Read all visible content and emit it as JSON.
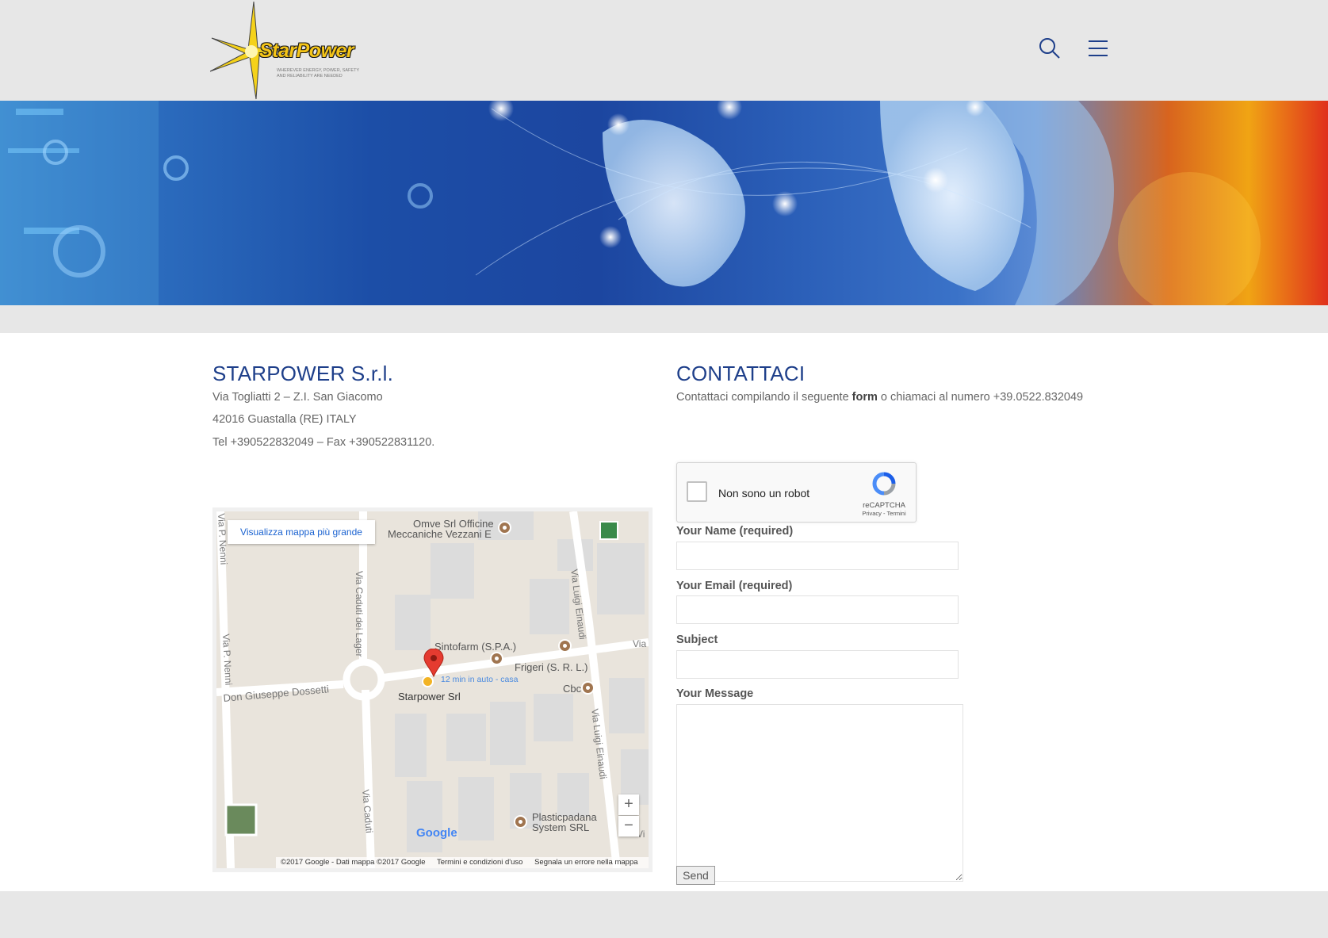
{
  "header": {
    "logo_text": "StarPower",
    "logo_tagline": "WHEREVER ENERGY, POWER, SAFETY AND RELIABILITY ARE NEEDED",
    "search_icon": "search-icon",
    "menu_icon": "hamburger-menu-icon"
  },
  "company": {
    "title": "STARPOWER S.r.l.",
    "address_line1": "Via Togliatti 2 – Z.I. San Giacomo",
    "address_line2": "42016 Guastalla (RE) ITALY",
    "phone_fax": "Tel +390522832049 – Fax +390522831120."
  },
  "map": {
    "view_larger": "Visualizza mappa più grande",
    "labels": {
      "omve": "Omve Srl Officine",
      "omve2": "Meccaniche Vezzani E",
      "sintofarm": "Sintofarm (S.P.A.)",
      "frigeri": "Frigeri (S. R. L.)",
      "cbc": "Cbc",
      "starpower": "Starpower Srl",
      "drive": "12 min in auto - casa",
      "dossetti": "Don Giuseppe Dossetti",
      "caduti_lager": "Via Caduti dei Lager",
      "einaudi_top": "Via Luigi Einaudi",
      "einaudi_bottom": "Via Luigi Einaudi",
      "nenni": "Via P. Nenni",
      "nenni_top": "Via P. Nenni",
      "caduti_bottom": "Via Caduti",
      "via_right": "Via",
      "vi_right": "Vi",
      "plasticpadana": "Plasticpadana",
      "plasticpadana2": "System SRL",
      "google": "Google"
    },
    "zoom_in": "+",
    "zoom_out": "−",
    "footer": {
      "copyright": "©2017 Google - Dati mappa ©2017 Google",
      "terms": "Termini e condizioni d'uso",
      "report": "Segnala un errore nella mappa"
    }
  },
  "contact": {
    "title": "CONTATTACI",
    "intro_before": "Contattaci compilando il seguente ",
    "intro_bold": "form",
    "intro_after": " o chiamaci al numero +39.0522.832049",
    "captcha_label": "Non sono un robot",
    "captcha_brand": "reCAPTCHA",
    "captcha_links": "Privacy - Termini",
    "fields": {
      "name": "Your Name (required)",
      "email": "Your Email (required)",
      "subject": "Subject",
      "message": "Your Message"
    },
    "send_label": "Send"
  },
  "colors": {
    "heading": "#1e3f8a",
    "background": "#e7e7e7",
    "logo_yellow": "#f5c518"
  }
}
